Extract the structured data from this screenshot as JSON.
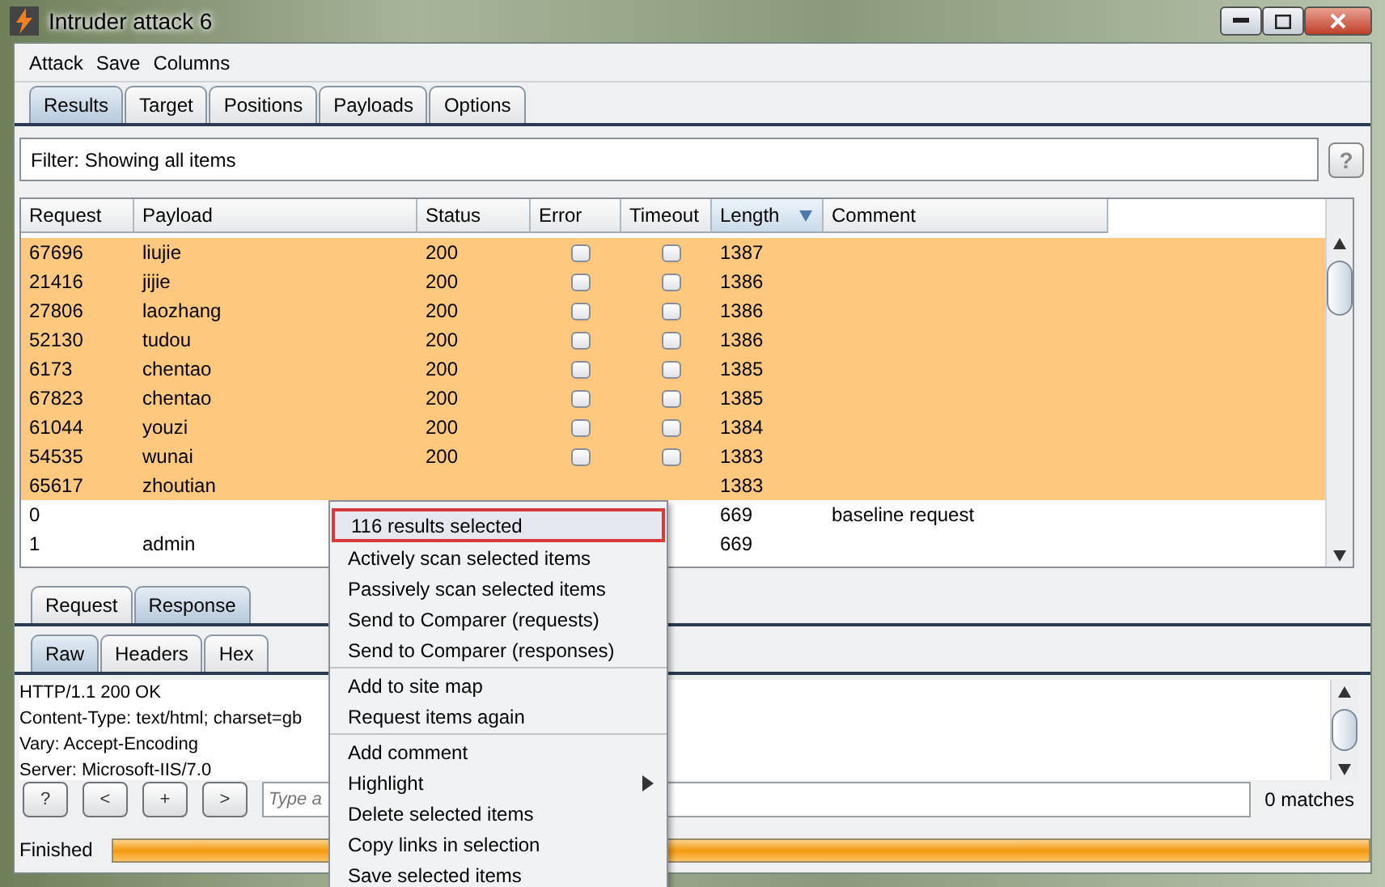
{
  "window": {
    "title": "Intruder attack 6"
  },
  "menu_bar": [
    "Attack",
    "Save",
    "Columns"
  ],
  "tabs": [
    {
      "label": "Results",
      "selected": true
    },
    {
      "label": "Target",
      "selected": false
    },
    {
      "label": "Positions",
      "selected": false
    },
    {
      "label": "Payloads",
      "selected": false
    },
    {
      "label": "Options",
      "selected": false
    }
  ],
  "filter": {
    "text": "Filter:  Showing all items",
    "help": "?"
  },
  "table": {
    "columns": [
      {
        "label": "Request",
        "sorted": false
      },
      {
        "label": "Payload",
        "sorted": false
      },
      {
        "label": "Status",
        "sorted": false
      },
      {
        "label": "Error",
        "sorted": false
      },
      {
        "label": "Timeout",
        "sorted": false
      },
      {
        "label": "Length",
        "sorted": true
      },
      {
        "label": "Comment",
        "sorted": false
      }
    ],
    "rows": [
      {
        "request": "67696",
        "payload": "liujie",
        "status": "200",
        "error": false,
        "timeout": false,
        "length": "1387",
        "selected": true
      },
      {
        "request": "21416",
        "payload": "jijie",
        "status": "200",
        "error": false,
        "timeout": false,
        "length": "1386",
        "selected": true
      },
      {
        "request": "27806",
        "payload": "laozhang",
        "status": "200",
        "error": false,
        "timeout": false,
        "length": "1386",
        "selected": true
      },
      {
        "request": "52130",
        "payload": "tudou",
        "status": "200",
        "error": false,
        "timeout": false,
        "length": "1386",
        "selected": true
      },
      {
        "request": "6173",
        "payload": "chentao",
        "status": "200",
        "error": false,
        "timeout": false,
        "length": "1385",
        "selected": true
      },
      {
        "request": "67823",
        "payload": "chentao",
        "status": "200",
        "error": false,
        "timeout": false,
        "length": "1385",
        "selected": true
      },
      {
        "request": "61044",
        "payload": "youzi",
        "status": "200",
        "error": false,
        "timeout": false,
        "length": "1384",
        "selected": true
      },
      {
        "request": "54535",
        "payload": "wunai",
        "status": "200",
        "error": false,
        "timeout": false,
        "length": "1383",
        "selected": true
      },
      {
        "request": "65617",
        "payload": "zhoutian",
        "length": "1383",
        "selected": true
      },
      {
        "request": "0",
        "payload": "",
        "length": "669",
        "comment": "baseline request",
        "selected": false
      },
      {
        "request": "1",
        "payload": "admin",
        "length": "669",
        "selected": false
      }
    ]
  },
  "message_tabs": [
    {
      "label": "Request",
      "selected": false
    },
    {
      "label": "Response",
      "selected": true
    }
  ],
  "view_tabs": [
    {
      "label": "Raw",
      "selected": true
    },
    {
      "label": "Headers",
      "selected": false
    },
    {
      "label": "Hex",
      "selected": false
    }
  ],
  "response_lines": [
    "HTTP/1.1 200 OK",
    "Content-Type: text/html; charset=gb",
    "Vary: Accept-Encoding",
    "Server: Microsoft-IIS/7.0"
  ],
  "search": {
    "buttons": [
      "?",
      "<",
      "+",
      ">"
    ],
    "placeholder": "Type a",
    "matches": "0 matches"
  },
  "status_bar": {
    "text": "Finished",
    "level": 1
  },
  "context_menu": {
    "groups": [
      [
        {
          "label": "116 results selected",
          "kind": "title"
        },
        {
          "label": "Actively scan selected items",
          "kind": "action"
        },
        {
          "label": "Passively scan selected items",
          "kind": "action"
        },
        {
          "label": "Send to Comparer (requests)",
          "kind": "action"
        },
        {
          "label": "Send to Comparer (responses)",
          "kind": "action"
        }
      ],
      [
        {
          "label": "Add to site map",
          "kind": "action"
        },
        {
          "label": "Request items again",
          "kind": "action"
        }
      ],
      [
        {
          "label": "Add comment",
          "kind": "action"
        },
        {
          "label": "Highlight",
          "kind": "submenu"
        },
        {
          "label": "Delete selected items",
          "kind": "action"
        },
        {
          "label": "Copy links in selection",
          "kind": "action"
        },
        {
          "label": "Save selected items",
          "kind": "action"
        }
      ]
    ]
  }
}
